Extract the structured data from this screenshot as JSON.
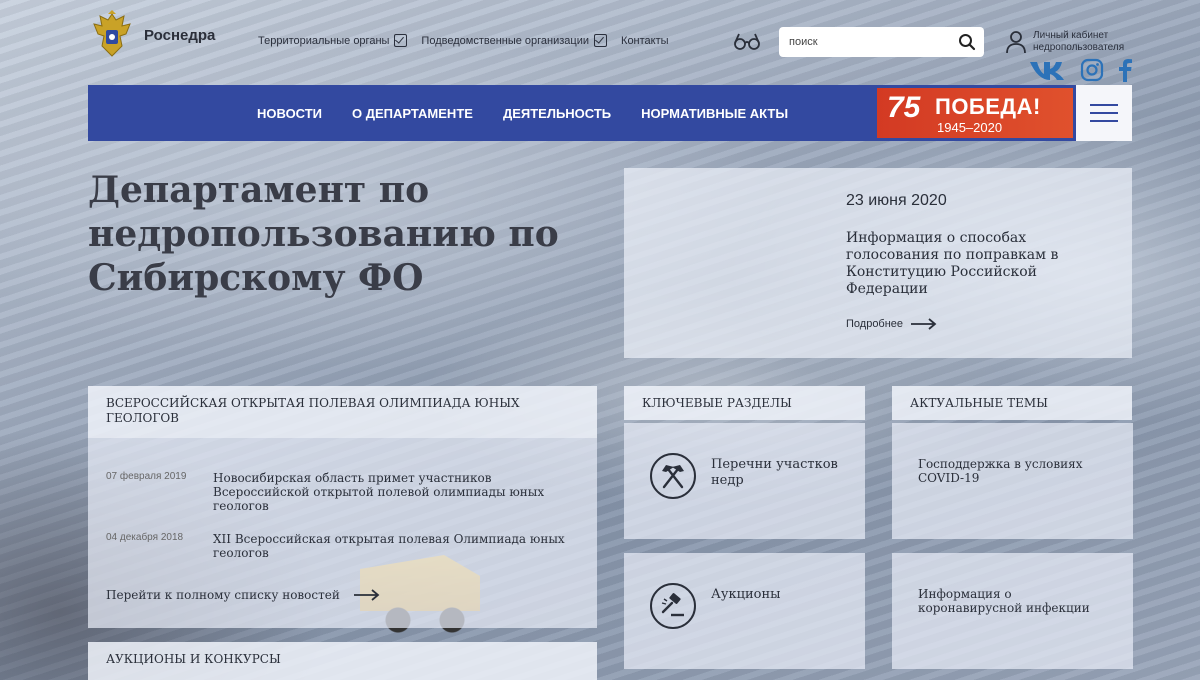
{
  "header": {
    "brand": "Роснедра",
    "topnav": [
      {
        "label": "Территориальные органы"
      },
      {
        "label": "Подведомственные организации"
      },
      {
        "label": "Контакты"
      }
    ],
    "search": {
      "placeholder": "поиск"
    },
    "cabinet": {
      "line1": "Личный кабинет",
      "line2": "недропользователя"
    },
    "social": [
      "vk-icon",
      "instagram-icon",
      "facebook-icon"
    ]
  },
  "mainnav": {
    "links": [
      "НОВОСТИ",
      "О ДЕПАРТАМЕНТЕ",
      "ДЕЯТЕЛЬНОСТЬ",
      "НОРМАТИВНЫЕ АКТЫ"
    ],
    "banner": {
      "number": "75",
      "title": "ПОБЕДА!",
      "years": "1945–2020"
    }
  },
  "hero": {
    "title": "Департамент по недропользованию по Сибирскому ФО"
  },
  "featured_news": {
    "date": "23 июня 2020",
    "text": "Информация о способах голосования по поправкам в Конституцию Российской Федерации",
    "more": "Подробнее"
  },
  "olympiad": {
    "heading": "ВСЕРОССИЙСКАЯ ОТКРЫТАЯ ПОЛЕВАЯ ОЛИМПИАДА ЮНЫХ ГЕОЛОГОВ",
    "items": [
      {
        "date": "07 февраля 2019",
        "title": "Новосибирская область примет участников Всероссийской открытой полевой олимпиады юных геологов"
      },
      {
        "date": "04 декабря 2018",
        "title": "XII Всероссийская открытая полевая Олимпиада юных геологов"
      }
    ],
    "all_link": "Перейти к полному списку новостей"
  },
  "auctions_section": {
    "heading": "АУКЦИОНЫ И КОНКУРСЫ"
  },
  "key_sections": {
    "heading": "КЛЮЧЕВЫЕ РАЗДЕЛЫ",
    "items": [
      {
        "label": "Перечни участков недр",
        "icon": "hammers-icon"
      },
      {
        "label": "Аукционы",
        "icon": "gavel-icon"
      }
    ]
  },
  "topics": {
    "heading": "АКТУАЛЬНЫЕ ТЕМЫ",
    "items": [
      {
        "label": "Господдержка в условиях COVID-19"
      },
      {
        "label": "Информация о коронавирусной инфекции"
      }
    ]
  },
  "colors": {
    "nav": "#3349a0",
    "banner": "#d33a23",
    "text": "#2a2f3a"
  }
}
